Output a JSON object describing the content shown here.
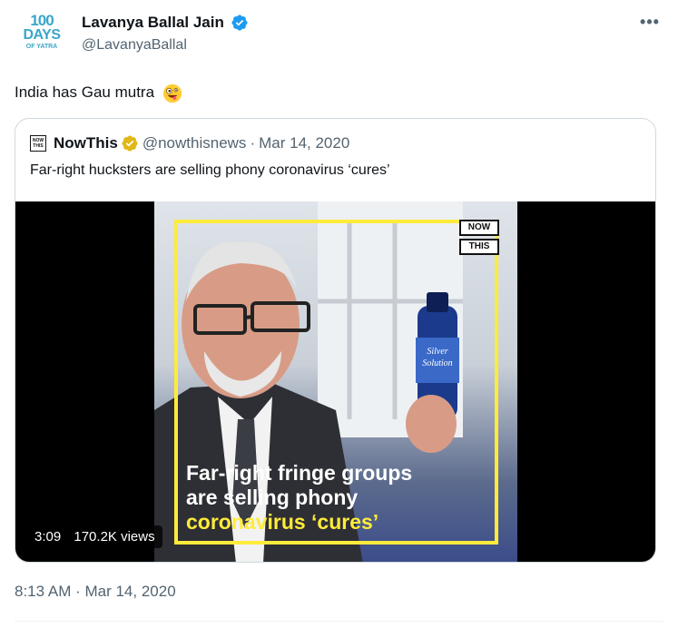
{
  "author": {
    "avatar_line1": "100",
    "avatar_line2": "DAYS",
    "avatar_line3": "OF YATRA",
    "display_name": "Lavanya Ballal Jain",
    "handle": "@LavanyaBallal",
    "verified": true
  },
  "tweet": {
    "text": "India has Gau mutra",
    "emoji": "zany-face"
  },
  "quoted": {
    "logo_top": "NOW",
    "logo_bottom": "THIS",
    "name": "NowThis",
    "handle": "@nowthisnews",
    "separator": "·",
    "date": "Mar 14, 2020",
    "text": "Far-right hucksters are selling phony coronavirus ‘cures’",
    "video": {
      "brand_top": "NOW",
      "brand_bottom": "THIS",
      "bottle_label_1": "Silver",
      "bottle_label_2": "Solution",
      "caption_line1": "Far-right fringe groups",
      "caption_line2": "are selling phony",
      "caption_line3": "coronavirus ‘cures’",
      "duration": "3:09",
      "views": "170.2K views"
    }
  },
  "timestamp": "8:13 AM · Mar 14, 2020",
  "colors": {
    "text": "#0f1419",
    "muted": "#536471",
    "verified_blue": "#1d9bf0",
    "gold_badge": "#e2b719",
    "yellow": "#ffeb3b"
  }
}
